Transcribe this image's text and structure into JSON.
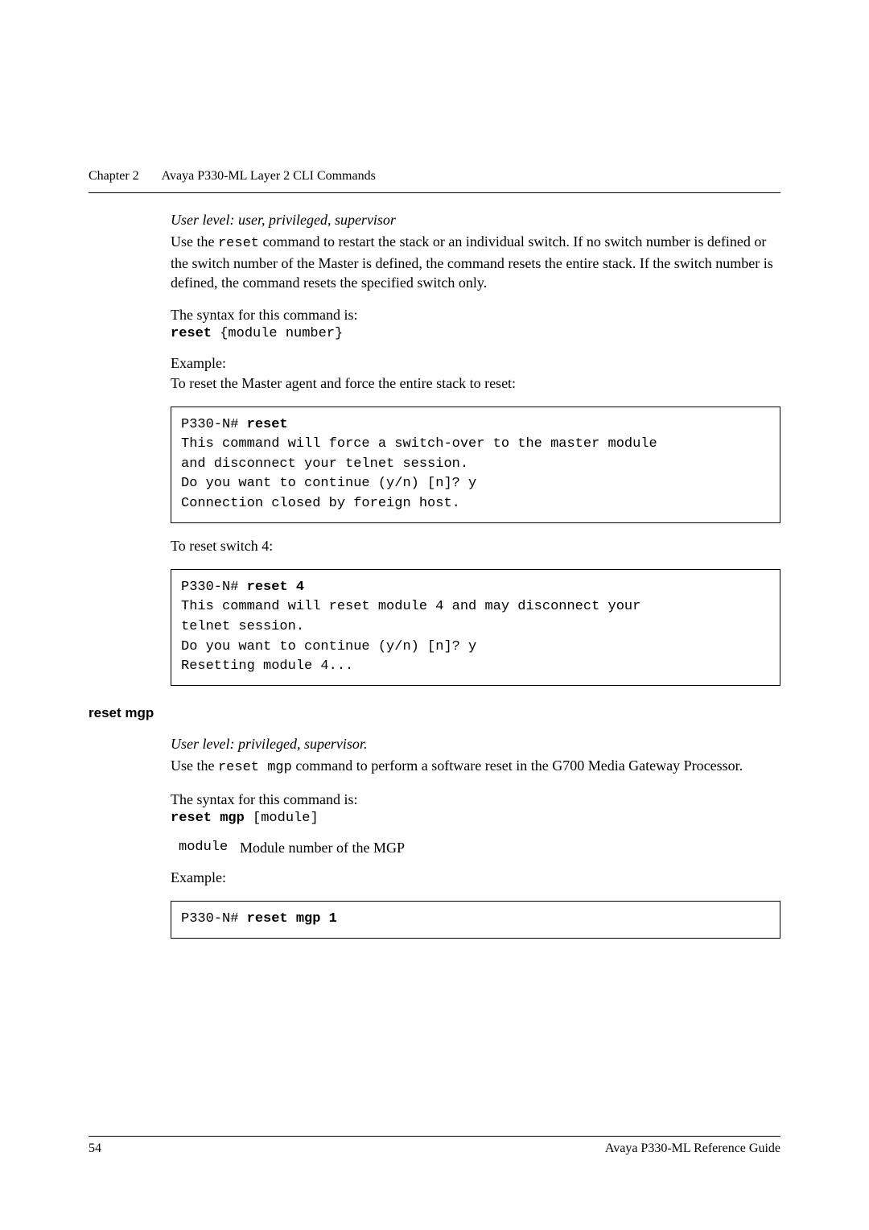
{
  "header": {
    "chapter": "Chapter 2",
    "title": "Avaya P330-ML Layer 2 CLI Commands"
  },
  "section1": {
    "user_level": "User level: user, privileged, supervisor",
    "intro_pre": "Use the ",
    "intro_cmd": "reset",
    "intro_post": " command to restart the stack or an individual switch. If no switch number is defined or the switch number of the Master is defined, the command resets the entire stack. If the switch number is defined, the command resets the specified switch only.",
    "syntax_label": "The syntax for this command is:",
    "syntax_bold": "reset",
    "syntax_rest": " {module number}",
    "example_label": "Example:",
    "example_desc": "To reset the Master agent and force the entire stack to reset:",
    "code1_prompt": "P330-N# ",
    "code1_cmd": "reset",
    "code1_line2": "This command will force a switch-over to the master module",
    "code1_line3": "and disconnect your telnet session.",
    "code1_line4": "Do you want to continue (y/n) [n]? y",
    "code1_line5": "Connection closed by foreign host.",
    "example2_desc": "To reset switch 4:",
    "code2_prompt": "P330-N# ",
    "code2_cmd": "reset 4",
    "code2_line2": "This command will reset module 4 and may disconnect your",
    "code2_line3": "telnet session.",
    "code2_line4": "Do you want to continue (y/n) [n]? y",
    "code2_line5": "Resetting module 4..."
  },
  "section2": {
    "heading": "reset mgp",
    "user_level": "User level: privileged, supervisor.",
    "intro_pre": "Use the ",
    "intro_cmd": "reset mgp",
    "intro_post": " command to perform a software reset in the G700 Media Gateway Processor.",
    "syntax_label": "The syntax for this command is:",
    "syntax_bold": "reset mgp",
    "syntax_rest": " [module]",
    "param_name": "module",
    "param_desc": "Module number of the MGP",
    "example_label": "Example:",
    "code1_prompt": "P330-N# ",
    "code1_cmd": "reset mgp 1"
  },
  "footer": {
    "page_number": "54",
    "doc_title": "Avaya P330-ML Reference Guide"
  }
}
